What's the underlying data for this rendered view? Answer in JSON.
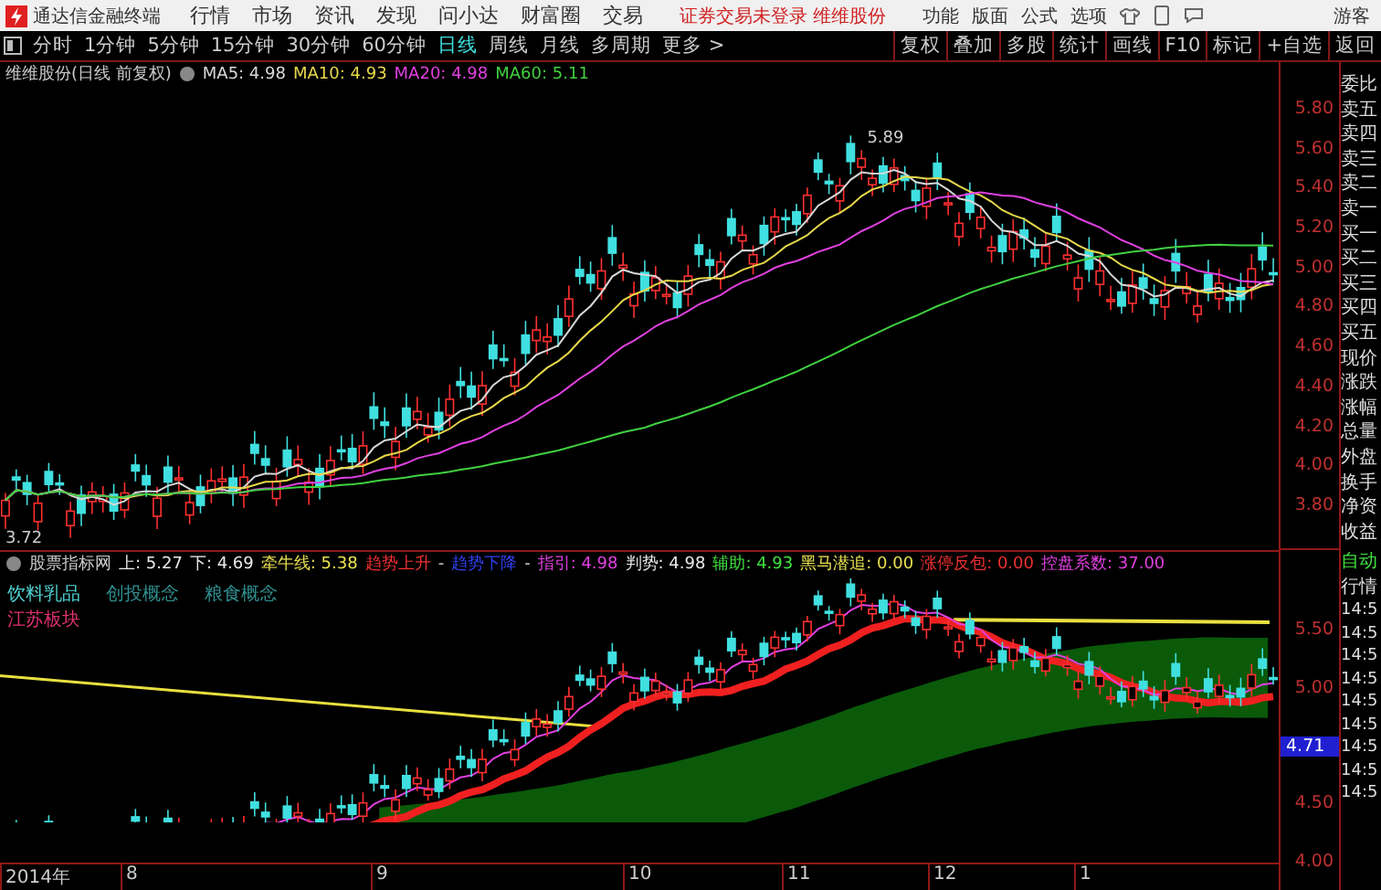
{
  "title_bar": {
    "app_name": "通达信金融终端",
    "menu": [
      "行情",
      "市场",
      "资讯",
      "发现",
      "问小达",
      "财富圈",
      "交易"
    ],
    "notice": "证券交易未登录 维维股份",
    "tools": [
      "功能",
      "版面",
      "公式",
      "选项"
    ],
    "user": "游客"
  },
  "period_bar": {
    "periods": [
      {
        "label": "分时",
        "selected": false
      },
      {
        "label": "1分钟",
        "selected": false
      },
      {
        "label": "5分钟",
        "selected": false
      },
      {
        "label": "15分钟",
        "selected": false
      },
      {
        "label": "30分钟",
        "selected": false
      },
      {
        "label": "60分钟",
        "selected": false
      },
      {
        "label": "日线",
        "selected": true
      },
      {
        "label": "周线",
        "selected": false
      },
      {
        "label": "月线",
        "selected": false
      },
      {
        "label": "多周期",
        "selected": false
      },
      {
        "label": "更多 >",
        "selected": false
      }
    ],
    "actions": [
      "复权",
      "叠加",
      "多股",
      "统计",
      "画线",
      "F10",
      "标记",
      "+自选",
      "返回"
    ]
  },
  "main_chart": {
    "title": "维维股份(日线 前复权)",
    "ma": [
      {
        "label": "MA5: 4.98",
        "color": "#d8d8d8"
      },
      {
        "label": "MA10: 4.93",
        "color": "#e8d84a"
      },
      {
        "label": "MA20: 4.98",
        "color": "#e040e0"
      },
      {
        "label": "MA60: 5.11",
        "color": "#40d040"
      }
    ],
    "peak_label": "5.89",
    "low_label": "3.72",
    "price_axis": [
      "5.80",
      "5.60",
      "5.40",
      "5.20",
      "5.00",
      "4.80",
      "4.60",
      "4.40",
      "4.20",
      "4.00",
      "3.80"
    ]
  },
  "indicator": {
    "name": "股票指标网",
    "items": [
      {
        "label": "上: 5.27",
        "color": "#e8e8e8"
      },
      {
        "label": "下: 4.69",
        "color": "#e8e8e8"
      },
      {
        "label": "牵牛线: 5.38",
        "color": "#e8e050"
      },
      {
        "label": "趋势上升",
        "color": "#f03030"
      },
      {
        "label": "-"
      },
      {
        "label": "趋势下降",
        "color": "#3040f0"
      },
      {
        "label": "-"
      },
      {
        "label": "指引: 4.98",
        "color": "#e040e0"
      },
      {
        "label": "判势: 4.98",
        "color": "#e8e8e8"
      },
      {
        "label": "辅助: 4.93",
        "color": "#40e040"
      },
      {
        "label": "黑马潜追: 0.00",
        "color": "#e8e050"
      },
      {
        "label": "涨停反包: 0.00",
        "color": "#f03030"
      },
      {
        "label": "控盘系数: 37.00",
        "color": "#e040e0"
      }
    ],
    "concepts": [
      "饮料乳品",
      "创投概念",
      "粮食概念"
    ],
    "region": "江苏板块",
    "price_axis": [
      {
        "label": "5.50",
        "highlighted": false
      },
      {
        "label": "5.00",
        "highlighted": false
      },
      {
        "label": "4.71",
        "highlighted": true
      },
      {
        "label": "4.50",
        "highlighted": false
      },
      {
        "label": "4.00",
        "highlighted": false
      }
    ]
  },
  "time_axis": [
    "2014年",
    "8",
    "9",
    "10",
    "11",
    "12",
    "1"
  ],
  "quote_panel": {
    "labels": [
      "委比",
      "卖五",
      "卖四",
      "卖三",
      "卖二",
      "卖一",
      "买一",
      "买二",
      "买三",
      "买四",
      "买五",
      "现价",
      "涨跌",
      "涨幅",
      "总量",
      "外盘",
      "换手",
      "净资",
      "收益"
    ],
    "auto_label": "自动",
    "market_label": "行情",
    "times": [
      "14:5",
      "14:5",
      "14:5",
      "14:5",
      "14:5",
      "14:5",
      "14:5",
      "14:5",
      "14:5"
    ]
  }
}
